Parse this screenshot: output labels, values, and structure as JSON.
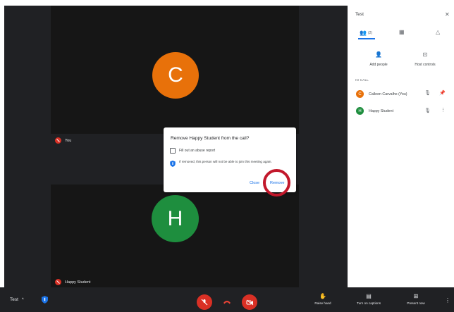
{
  "colors": {
    "accent": "#1a73e8",
    "stage_bg": "#202124",
    "danger": "#d93025",
    "highlight_ring": "#c2182b"
  },
  "tiles": {
    "top": {
      "initial": "C",
      "color": "#e8710a",
      "name": "You"
    },
    "bottom": {
      "initial": "H",
      "color": "#1e8e3e",
      "name": "Happy Student"
    }
  },
  "sidebar": {
    "title": "Test",
    "close_icon": "close-icon",
    "tabs": [
      {
        "icon": "people-icon",
        "count": "(2)"
      },
      {
        "icon": "chat-icon"
      },
      {
        "icon": "activities-icon"
      }
    ],
    "actions": [
      {
        "label": "Add people",
        "icon": "person-add-icon"
      },
      {
        "label": "Host controls",
        "icon": "host-controls-icon"
      }
    ],
    "section_label": "IN CALL",
    "people": [
      {
        "initial": "C",
        "name": "Calleen Carvalho (You)",
        "color": "#e8710a"
      },
      {
        "initial": "H",
        "name": "Happy Student",
        "color": "#1e8e3e"
      }
    ]
  },
  "dialog": {
    "title": "Remove Happy Student from the call?",
    "checkbox_label": "Fill out an abuse report",
    "info_text": "If removed, this person will not be able to join this meeting again.",
    "close_label": "Close",
    "remove_label": "Remove"
  },
  "bottom_bar": {
    "meeting_name": "Test",
    "actions": [
      {
        "label": "Raise hand",
        "icon": "hand-icon"
      },
      {
        "label": "Turn on captions",
        "icon": "captions-icon"
      },
      {
        "label": "Present now",
        "icon": "present-icon"
      }
    ]
  }
}
